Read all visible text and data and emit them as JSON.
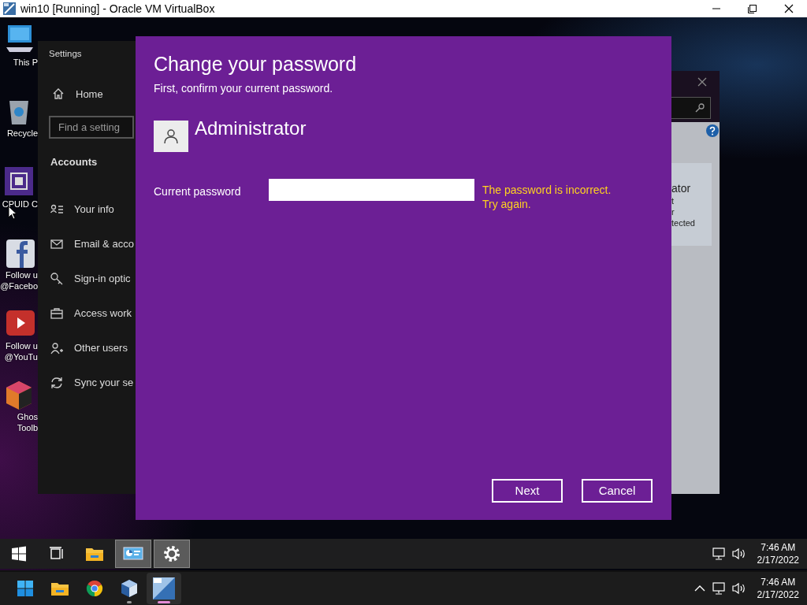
{
  "host_window": {
    "title": "win10 [Running] - Oracle VM VirtualBox"
  },
  "desktop_icons": [
    {
      "kind": "computer",
      "lines": [
        "This P"
      ]
    },
    {
      "kind": "recycle-bin",
      "lines": [
        "Recycle"
      ]
    },
    {
      "kind": "chip",
      "lines": [
        "CPUID C"
      ]
    },
    {
      "kind": "facebook",
      "lines": [
        "Follow u",
        "@Facebo"
      ]
    },
    {
      "kind": "youtube",
      "lines": [
        "Follow u",
        "@YouTu"
      ]
    },
    {
      "kind": "box",
      "lines": [
        "Ghos",
        "Toolb"
      ]
    }
  ],
  "settings_window": {
    "title": "Settings",
    "home": "Home",
    "search": {
      "placeholder": "Find a setting"
    },
    "section": "Accounts",
    "nav": [
      {
        "kind": "info",
        "label": "Your info"
      },
      {
        "kind": "mail",
        "label": "Email & acco"
      },
      {
        "kind": "key",
        "label": "Sign-in optic"
      },
      {
        "kind": "briefcase",
        "label": "Access work"
      },
      {
        "kind": "person-add",
        "label": "Other users"
      },
      {
        "kind": "sync",
        "label": "Sync your se"
      }
    ]
  },
  "back_window": {
    "text_lines": [
      "ator",
      "t",
      "r",
      "tected"
    ]
  },
  "dialog": {
    "title": "Change your password",
    "subtitle": "First, confirm your current password.",
    "user_name": "Administrator",
    "field_label": "Current password",
    "error_lines": [
      "The password is incorrect.",
      "Try again."
    ],
    "buttons": [
      {
        "label": "Next"
      },
      {
        "label": "Cancel"
      }
    ]
  },
  "vm_taskbar": {
    "apps": [
      {
        "kind": "start",
        "selected": false
      },
      {
        "kind": "task-view",
        "selected": false
      },
      {
        "kind": "explorer",
        "selected": false
      },
      {
        "kind": "control-panel",
        "selected": true
      },
      {
        "kind": "settings",
        "selected": true
      }
    ],
    "time": "7:46 AM",
    "date": "2/17/2022"
  },
  "host_taskbar": {
    "apps": [
      {
        "kind": "start11",
        "selected": false,
        "running": false
      },
      {
        "kind": "explorer",
        "selected": false,
        "running": false
      },
      {
        "kind": "chrome",
        "selected": false,
        "running": false
      },
      {
        "kind": "virtualbox",
        "selected": false,
        "running": true
      },
      {
        "kind": "vm-app",
        "selected": true,
        "running": true
      }
    ],
    "time": "7:46 AM",
    "date": "2/17/2022"
  }
}
